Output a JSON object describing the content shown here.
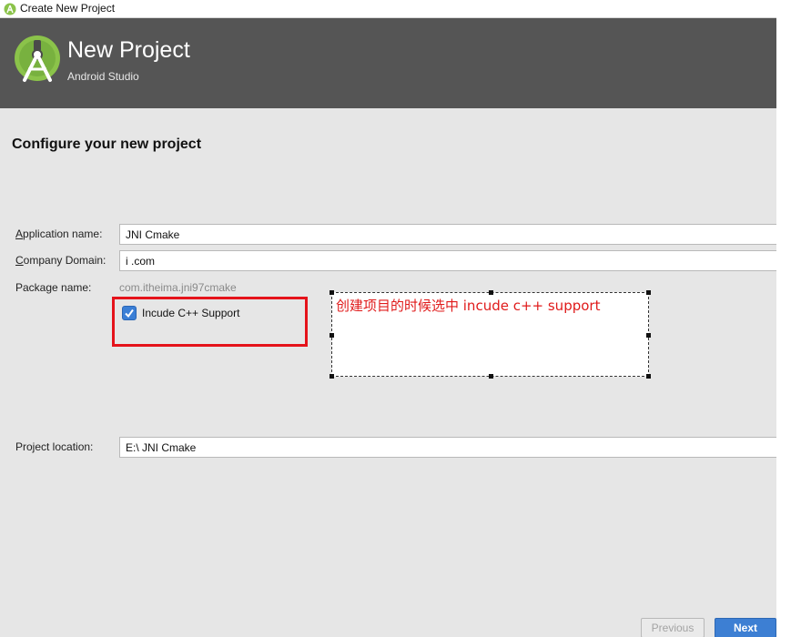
{
  "window": {
    "title": "Create New Project"
  },
  "banner": {
    "heading": "New Project",
    "subheading": "Android Studio"
  },
  "page": {
    "section_title": "Configure your new project"
  },
  "form": {
    "app_name": {
      "label_mnemonic": "A",
      "label_rest": "pplication name:",
      "value": "JNI    Cmake"
    },
    "company_domain": {
      "label_mnemonic": "C",
      "label_rest": "ompany Domain:",
      "value": "i            .com"
    },
    "package_name": {
      "label": "Package name:",
      "value": "com.itheima.jni97cmake"
    },
    "cpp_support": {
      "label": "Incude C++ Support",
      "checked": true
    },
    "project_location": {
      "label": "Project location:",
      "value": "E:\\             JNI    Cmake"
    }
  },
  "annotation": {
    "text": "创建项目的时候选中 incude c++ support",
    "color": "#e01b1b"
  },
  "buttons": {
    "previous": "Previous",
    "next": "Next"
  },
  "colors": {
    "banner": "#555555",
    "accent": "#3d7fd3",
    "highlight": "#e5131b",
    "logo_green": "#8bc34a"
  }
}
